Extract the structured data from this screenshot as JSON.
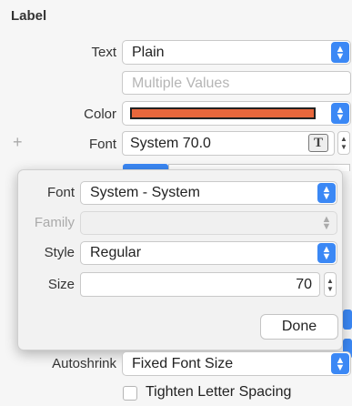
{
  "section": {
    "title": "Label"
  },
  "text_row": {
    "label": "Text",
    "value": "Plain"
  },
  "text_field": {
    "placeholder": "Multiple Values"
  },
  "color_row": {
    "label": "Color",
    "swatch": "#e8673c"
  },
  "font_row": {
    "plus": "+",
    "label": "Font",
    "value": "System 70.0"
  },
  "popover": {
    "font": {
      "label": "Font",
      "value": "System - System"
    },
    "family": {
      "label": "Family",
      "value": ""
    },
    "style": {
      "label": "Style",
      "value": "Regular"
    },
    "size": {
      "label": "Size",
      "value": "70"
    },
    "done_label": "Done"
  },
  "autoshrink_row": {
    "label": "Autoshrink",
    "value": "Fixed Font Size"
  },
  "tighten": {
    "label": "Tighten Letter Spacing",
    "checked": false
  },
  "colors": {
    "accent": "#3b88f5"
  }
}
